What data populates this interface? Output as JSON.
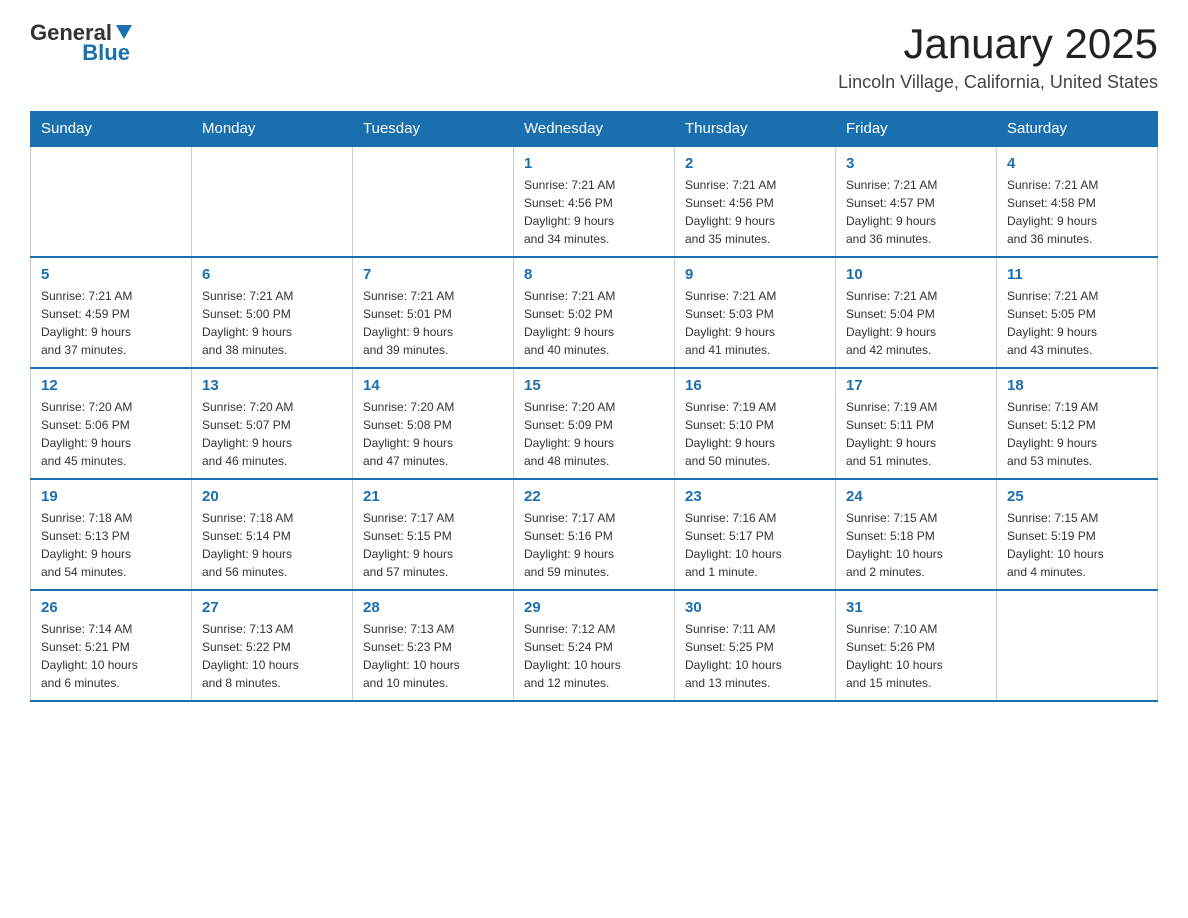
{
  "header": {
    "logo_general": "General",
    "logo_blue": "Blue",
    "month_title": "January 2025",
    "location": "Lincoln Village, California, United States"
  },
  "days_of_week": [
    "Sunday",
    "Monday",
    "Tuesday",
    "Wednesday",
    "Thursday",
    "Friday",
    "Saturday"
  ],
  "weeks": [
    [
      {
        "day": "",
        "info": ""
      },
      {
        "day": "",
        "info": ""
      },
      {
        "day": "",
        "info": ""
      },
      {
        "day": "1",
        "info": "Sunrise: 7:21 AM\nSunset: 4:56 PM\nDaylight: 9 hours\nand 34 minutes."
      },
      {
        "day": "2",
        "info": "Sunrise: 7:21 AM\nSunset: 4:56 PM\nDaylight: 9 hours\nand 35 minutes."
      },
      {
        "day": "3",
        "info": "Sunrise: 7:21 AM\nSunset: 4:57 PM\nDaylight: 9 hours\nand 36 minutes."
      },
      {
        "day": "4",
        "info": "Sunrise: 7:21 AM\nSunset: 4:58 PM\nDaylight: 9 hours\nand 36 minutes."
      }
    ],
    [
      {
        "day": "5",
        "info": "Sunrise: 7:21 AM\nSunset: 4:59 PM\nDaylight: 9 hours\nand 37 minutes."
      },
      {
        "day": "6",
        "info": "Sunrise: 7:21 AM\nSunset: 5:00 PM\nDaylight: 9 hours\nand 38 minutes."
      },
      {
        "day": "7",
        "info": "Sunrise: 7:21 AM\nSunset: 5:01 PM\nDaylight: 9 hours\nand 39 minutes."
      },
      {
        "day": "8",
        "info": "Sunrise: 7:21 AM\nSunset: 5:02 PM\nDaylight: 9 hours\nand 40 minutes."
      },
      {
        "day": "9",
        "info": "Sunrise: 7:21 AM\nSunset: 5:03 PM\nDaylight: 9 hours\nand 41 minutes."
      },
      {
        "day": "10",
        "info": "Sunrise: 7:21 AM\nSunset: 5:04 PM\nDaylight: 9 hours\nand 42 minutes."
      },
      {
        "day": "11",
        "info": "Sunrise: 7:21 AM\nSunset: 5:05 PM\nDaylight: 9 hours\nand 43 minutes."
      }
    ],
    [
      {
        "day": "12",
        "info": "Sunrise: 7:20 AM\nSunset: 5:06 PM\nDaylight: 9 hours\nand 45 minutes."
      },
      {
        "day": "13",
        "info": "Sunrise: 7:20 AM\nSunset: 5:07 PM\nDaylight: 9 hours\nand 46 minutes."
      },
      {
        "day": "14",
        "info": "Sunrise: 7:20 AM\nSunset: 5:08 PM\nDaylight: 9 hours\nand 47 minutes."
      },
      {
        "day": "15",
        "info": "Sunrise: 7:20 AM\nSunset: 5:09 PM\nDaylight: 9 hours\nand 48 minutes."
      },
      {
        "day": "16",
        "info": "Sunrise: 7:19 AM\nSunset: 5:10 PM\nDaylight: 9 hours\nand 50 minutes."
      },
      {
        "day": "17",
        "info": "Sunrise: 7:19 AM\nSunset: 5:11 PM\nDaylight: 9 hours\nand 51 minutes."
      },
      {
        "day": "18",
        "info": "Sunrise: 7:19 AM\nSunset: 5:12 PM\nDaylight: 9 hours\nand 53 minutes."
      }
    ],
    [
      {
        "day": "19",
        "info": "Sunrise: 7:18 AM\nSunset: 5:13 PM\nDaylight: 9 hours\nand 54 minutes."
      },
      {
        "day": "20",
        "info": "Sunrise: 7:18 AM\nSunset: 5:14 PM\nDaylight: 9 hours\nand 56 minutes."
      },
      {
        "day": "21",
        "info": "Sunrise: 7:17 AM\nSunset: 5:15 PM\nDaylight: 9 hours\nand 57 minutes."
      },
      {
        "day": "22",
        "info": "Sunrise: 7:17 AM\nSunset: 5:16 PM\nDaylight: 9 hours\nand 59 minutes."
      },
      {
        "day": "23",
        "info": "Sunrise: 7:16 AM\nSunset: 5:17 PM\nDaylight: 10 hours\nand 1 minute."
      },
      {
        "day": "24",
        "info": "Sunrise: 7:15 AM\nSunset: 5:18 PM\nDaylight: 10 hours\nand 2 minutes."
      },
      {
        "day": "25",
        "info": "Sunrise: 7:15 AM\nSunset: 5:19 PM\nDaylight: 10 hours\nand 4 minutes."
      }
    ],
    [
      {
        "day": "26",
        "info": "Sunrise: 7:14 AM\nSunset: 5:21 PM\nDaylight: 10 hours\nand 6 minutes."
      },
      {
        "day": "27",
        "info": "Sunrise: 7:13 AM\nSunset: 5:22 PM\nDaylight: 10 hours\nand 8 minutes."
      },
      {
        "day": "28",
        "info": "Sunrise: 7:13 AM\nSunset: 5:23 PM\nDaylight: 10 hours\nand 10 minutes."
      },
      {
        "day": "29",
        "info": "Sunrise: 7:12 AM\nSunset: 5:24 PM\nDaylight: 10 hours\nand 12 minutes."
      },
      {
        "day": "30",
        "info": "Sunrise: 7:11 AM\nSunset: 5:25 PM\nDaylight: 10 hours\nand 13 minutes."
      },
      {
        "day": "31",
        "info": "Sunrise: 7:10 AM\nSunset: 5:26 PM\nDaylight: 10 hours\nand 15 minutes."
      },
      {
        "day": "",
        "info": ""
      }
    ]
  ]
}
